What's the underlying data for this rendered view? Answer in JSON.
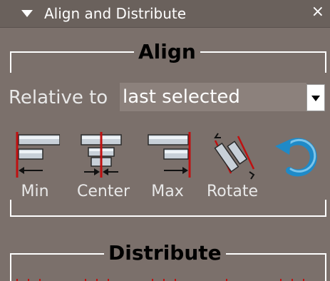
{
  "panel": {
    "title": "Align and Distribute",
    "close_glyph": "×",
    "collapse_icon": "triangle-down-icon"
  },
  "align": {
    "heading": "Align",
    "relative_label": "Relative to",
    "relative_value": "last selected",
    "tools": [
      {
        "label": "Min",
        "icon": "align-min-icon"
      },
      {
        "label": "Center",
        "icon": "align-center-icon"
      },
      {
        "label": "Max",
        "icon": "align-max-icon"
      },
      {
        "label": "Rotate",
        "icon": "rotate-align-icon"
      },
      {
        "label": "",
        "icon": "undo-rotate-icon"
      }
    ]
  },
  "distribute": {
    "heading": "Distribute"
  },
  "colors": {
    "panel_bg": "#7b706b",
    "titlebar_bg": "#6a615c",
    "accent_red": "#c01010",
    "rotate_blue": "#1f8ac8"
  }
}
